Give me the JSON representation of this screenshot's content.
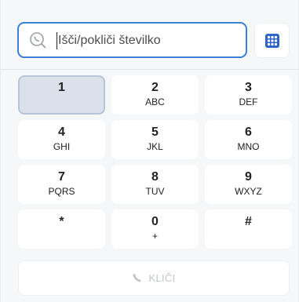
{
  "search": {
    "placeholder": "Išči/pokliči številko",
    "value": ""
  },
  "keys": [
    {
      "digit": "1",
      "letters": ""
    },
    {
      "digit": "2",
      "letters": "ABC"
    },
    {
      "digit": "3",
      "letters": "DEF"
    },
    {
      "digit": "4",
      "letters": "GHI"
    },
    {
      "digit": "5",
      "letters": "JKL"
    },
    {
      "digit": "6",
      "letters": "MNO"
    },
    {
      "digit": "7",
      "letters": "PQRS"
    },
    {
      "digit": "8",
      "letters": "TUV"
    },
    {
      "digit": "9",
      "letters": "WXYZ"
    },
    {
      "digit": "*",
      "letters": ""
    },
    {
      "digit": "0",
      "letters": "+"
    },
    {
      "digit": "#",
      "letters": ""
    }
  ],
  "active_key": "1",
  "call_button": {
    "label": "KLIČI"
  },
  "icons": {
    "search": "phone-search-icon",
    "keypad": "dialpad-grid-icon",
    "call": "phone-icon"
  },
  "colors": {
    "accent": "#3b7fd6",
    "keypad_icon": "#2f64c8",
    "disabled_text": "#c2c6cb",
    "active_key_bg": "#dbe1ea"
  }
}
